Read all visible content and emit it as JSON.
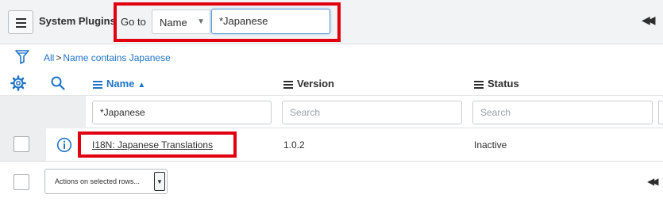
{
  "header": {
    "list_title": "System Plugins",
    "goto_label": "Go to",
    "field_select_value": "Name",
    "search_value": "*Japanese",
    "first_page_glyph": "◀◀"
  },
  "breadcrumb": {
    "all": "All",
    "separator": ">",
    "condition": "Name contains Japanese"
  },
  "columns": {
    "name": "Name",
    "version": "Version",
    "status": "Status"
  },
  "column_search": {
    "name_value": "*Japanese",
    "version_placeholder": "Search",
    "status_placeholder": "Search"
  },
  "rows": [
    {
      "name": "I18N: Japanese Translations",
      "version": "1.0.2",
      "status": "Inactive"
    }
  ],
  "footer": {
    "actions_label": "Actions on selected rows...",
    "first_page_glyph": "◀◀"
  },
  "colors": {
    "link_blue": "#1f74c8",
    "highlight_red": "#e10010",
    "header_bg": "#f2f3f4"
  }
}
